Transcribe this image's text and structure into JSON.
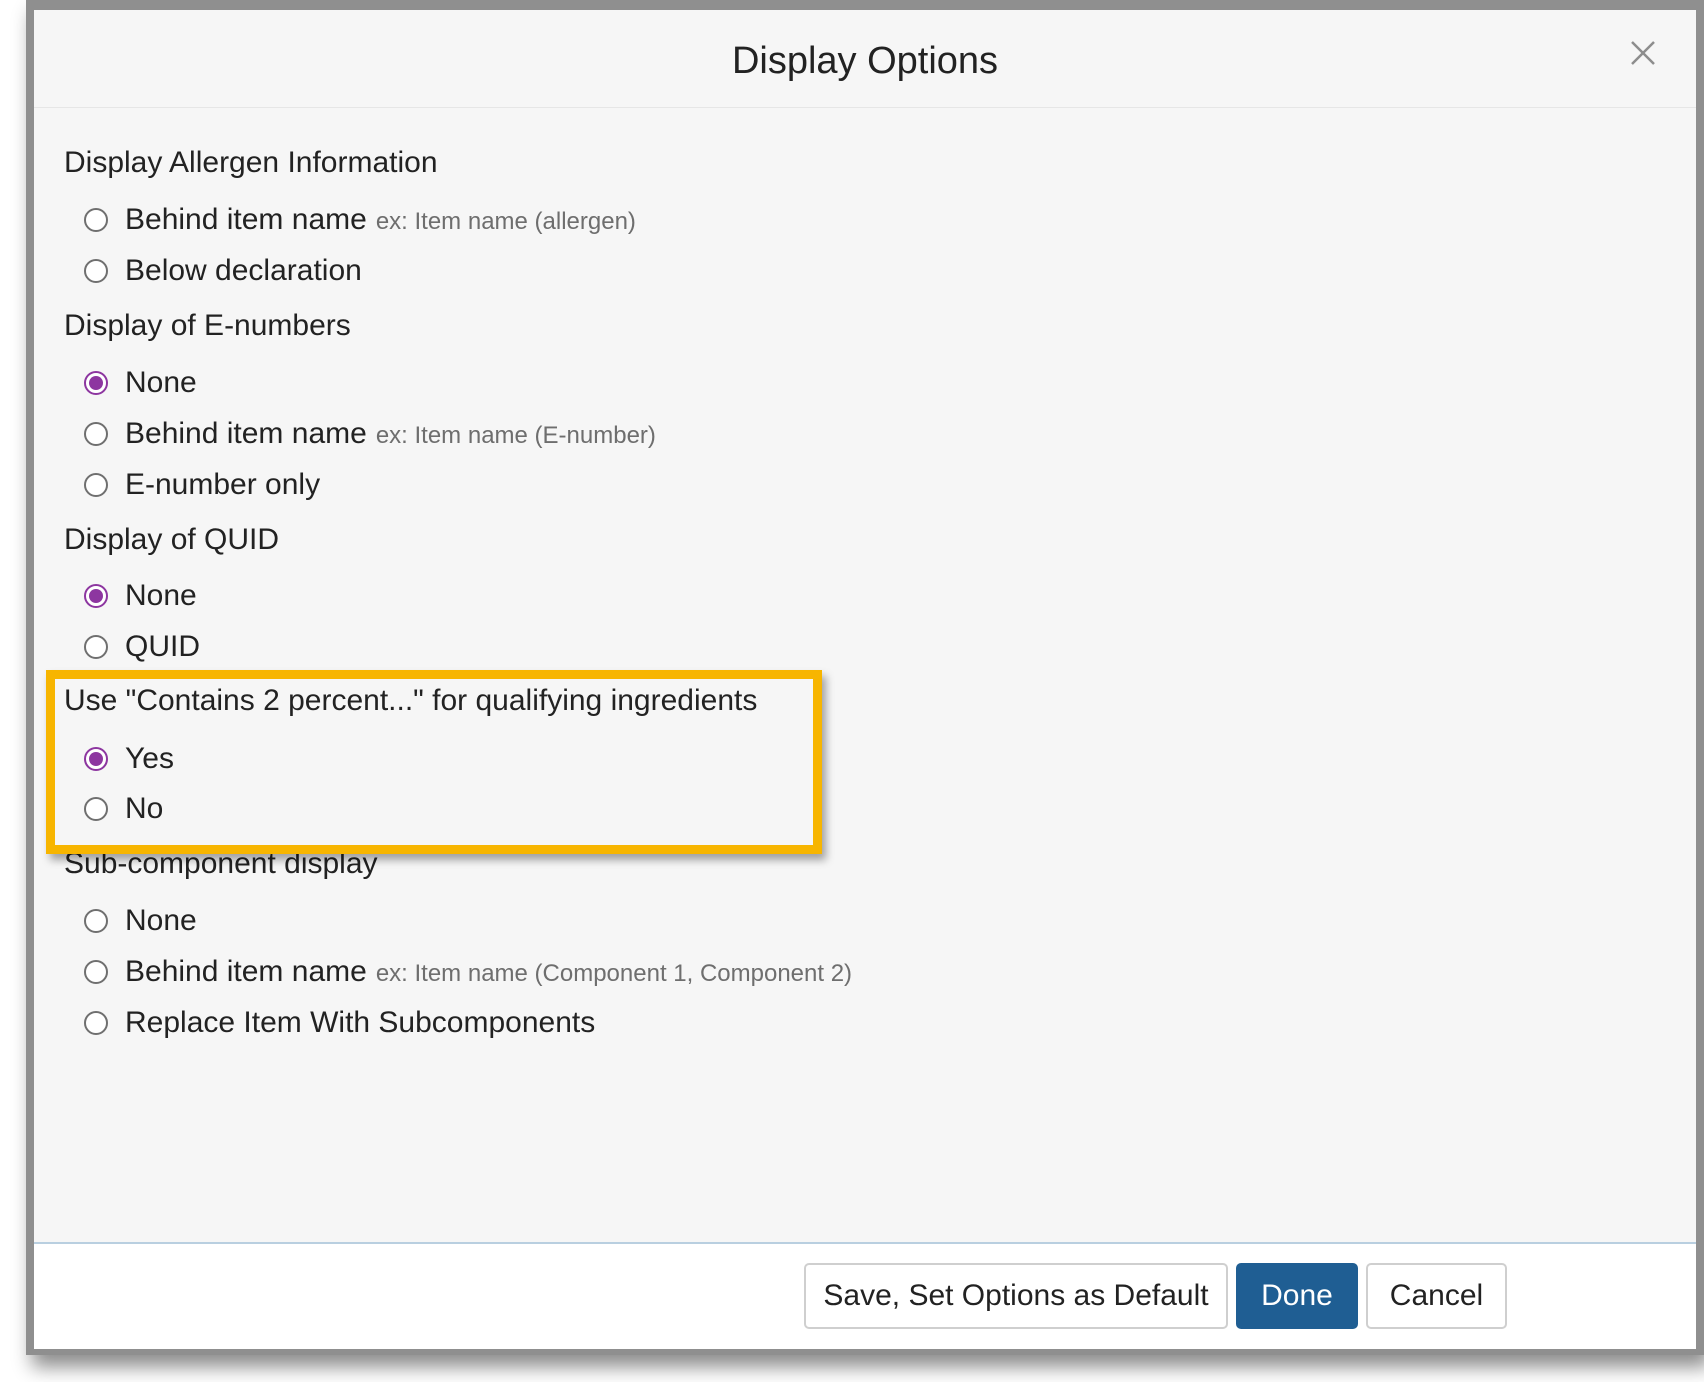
{
  "dialog": {
    "title": "Display Options",
    "close_icon": "close-icon"
  },
  "sections": {
    "allergen": {
      "title": "Display Allergen Information",
      "options": [
        {
          "label": "Behind item name",
          "example": "ex: Item name (allergen)",
          "checked": false
        },
        {
          "label": "Below declaration",
          "checked": false
        }
      ]
    },
    "enumbers": {
      "title": "Display of E-numbers",
      "options": [
        {
          "label": "None",
          "checked": true
        },
        {
          "label": "Behind item name",
          "example": "ex: Item name (E-number)",
          "checked": false
        },
        {
          "label": "E-number only",
          "checked": false
        }
      ]
    },
    "quid": {
      "title": "Display of QUID",
      "options": [
        {
          "label": "None",
          "checked": true
        },
        {
          "label": "QUID",
          "checked": false
        }
      ]
    },
    "contains2": {
      "title": "Use \"Contains 2 percent...\" for qualifying ingredients",
      "options": [
        {
          "label": "Yes",
          "checked": true
        },
        {
          "label": "No",
          "checked": false
        }
      ]
    },
    "subcomponent": {
      "title": "Sub-component display",
      "options": [
        {
          "label": "None",
          "checked": false
        },
        {
          "label": "Behind item name",
          "example": "ex: Item name (Component 1, Component 2)",
          "checked": false
        },
        {
          "label": "Replace Item With Subcomponents",
          "checked": false
        }
      ]
    }
  },
  "footer": {
    "save_default_label": "Save, Set Options as Default",
    "done_label": "Done",
    "cancel_label": "Cancel"
  },
  "colors": {
    "accent_radio": "#8d36a0",
    "primary_button": "#1f5e93",
    "highlight_box": "#f7b500"
  }
}
